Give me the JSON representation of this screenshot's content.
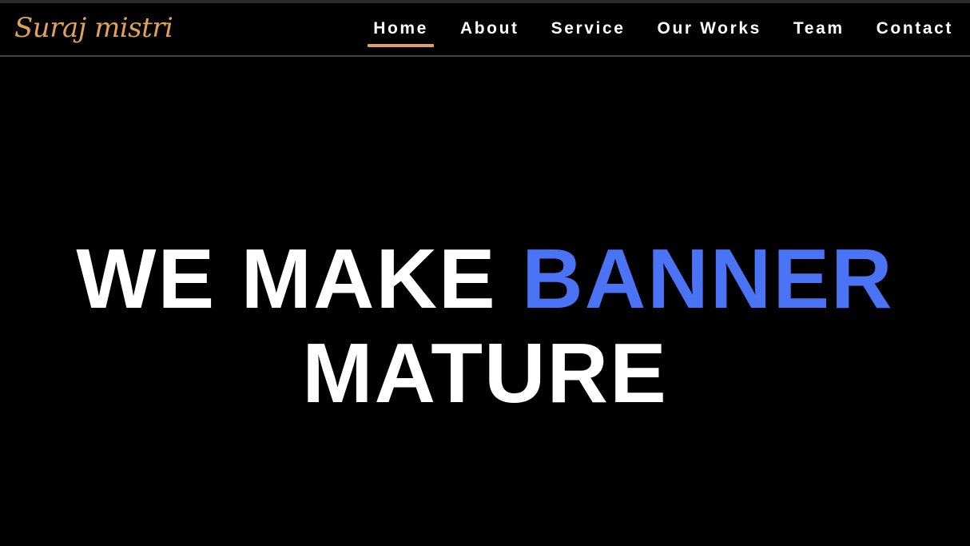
{
  "brand": {
    "logo_text": "Suraj mistri"
  },
  "nav": {
    "items": [
      {
        "label": "Home",
        "active": true
      },
      {
        "label": "About",
        "active": false
      },
      {
        "label": "Service",
        "active": false
      },
      {
        "label": "Our Works",
        "active": false
      },
      {
        "label": "Team",
        "active": false
      },
      {
        "label": "Contact",
        "active": false
      }
    ]
  },
  "hero": {
    "line1_prefix": "WE MAKE",
    "line1_highlight": "BANNER",
    "line2": "MATURE"
  },
  "colors": {
    "background": "#000000",
    "accent": "#e0a25a",
    "highlight": "#4a74f5",
    "text": "#ffffff"
  }
}
